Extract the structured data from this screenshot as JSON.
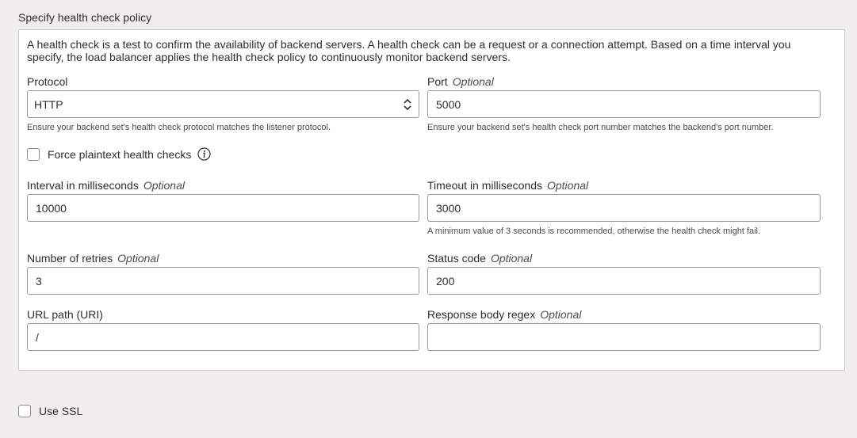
{
  "section": {
    "title": "Specify health check policy"
  },
  "description": "A health check is a test to confirm the availability of backend servers. A health check can be a request or a connection attempt. Based on a time interval you specify, the load balancer applies the health check policy to continuously monitor backend servers.",
  "protocol": {
    "label": "Protocol",
    "value": "HTTP",
    "help": "Ensure your backend set's health check protocol matches the listener protocol."
  },
  "port": {
    "label": "Port",
    "optional": "Optional",
    "value": "5000",
    "help": "Ensure your backend set's health check port number matches the backend's port number."
  },
  "force_plaintext": {
    "label": "Force plaintext health checks",
    "checked": false
  },
  "interval": {
    "label": "Interval in milliseconds",
    "optional": "Optional",
    "value": "10000"
  },
  "timeout": {
    "label": "Timeout in milliseconds",
    "optional": "Optional",
    "value": "3000",
    "help": "A minimum value of 3 seconds is recommended, otherwise the health check might fail."
  },
  "retries": {
    "label": "Number of retries",
    "optional": "Optional",
    "value": "3"
  },
  "status_code": {
    "label": "Status code",
    "optional": "Optional",
    "value": "200"
  },
  "url_path": {
    "label": "URL path (URI)",
    "value": "/"
  },
  "response_regex": {
    "label": "Response body regex",
    "optional": "Optional",
    "value": ""
  },
  "use_ssl": {
    "label": "Use SSL",
    "checked": false
  }
}
